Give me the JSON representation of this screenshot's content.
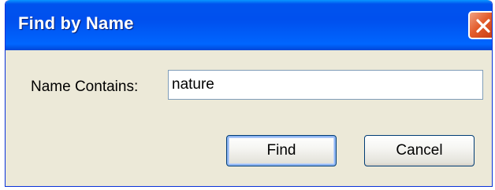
{
  "window": {
    "title": "Find by Name",
    "close_icon": "close-icon"
  },
  "form": {
    "name_label": "Name Contains:",
    "name_value": "nature"
  },
  "buttons": {
    "find_label": "Find",
    "cancel_label": "Cancel"
  },
  "colors": {
    "titlebar": "#0054e3",
    "window_body": "#ece9d8",
    "close_button": "#e35d2c",
    "input_border": "#7f9db9",
    "button_border": "#003c74"
  }
}
